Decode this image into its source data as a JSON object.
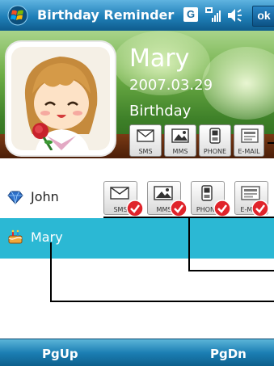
{
  "titlebar": {
    "title": "Birthday Reminder",
    "tray_g": "G",
    "ok_label": "ok"
  },
  "contact": {
    "name": "Mary",
    "date": "2007.03.29",
    "event": "Birthday"
  },
  "header_actions": [
    {
      "label": "SMS",
      "icon": "envelope-icon"
    },
    {
      "label": "MMS",
      "icon": "picture-icon"
    },
    {
      "label": "PHONE",
      "icon": "phone-icon"
    },
    {
      "label": "E-MAIL",
      "icon": "email-icon"
    }
  ],
  "list": [
    {
      "name": "John",
      "icon": "heart-gem-icon",
      "selected": false
    },
    {
      "name": "Mary",
      "icon": "cake-icon",
      "selected": true
    }
  ],
  "list_actions": [
    {
      "label": "SMS"
    },
    {
      "label": "MMS"
    },
    {
      "label": "PHONE"
    },
    {
      "label": "E-MAIL"
    }
  ],
  "softkeys": {
    "left": "PgUp",
    "right": "PgDn"
  },
  "colors": {
    "titlebar": "#1f7fb8",
    "selected_row": "#2bb8d4",
    "check": "#e0242b"
  }
}
